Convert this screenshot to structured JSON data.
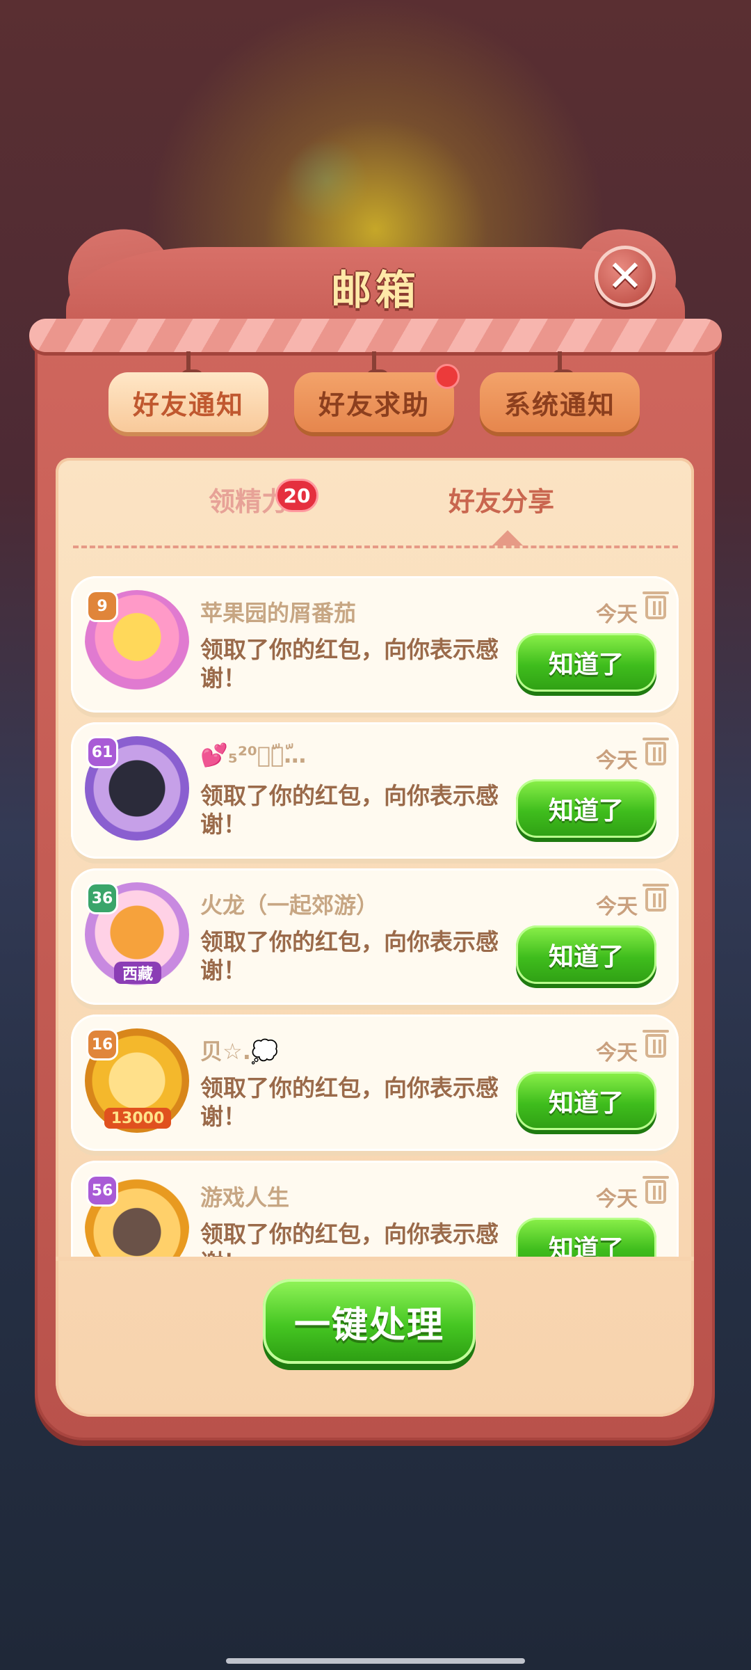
{
  "window": {
    "title": "邮箱",
    "close_icon": "close-icon"
  },
  "tabs": [
    {
      "label": "好友通知",
      "active": true,
      "notify": false
    },
    {
      "label": "好友求助",
      "active": false,
      "notify": true
    },
    {
      "label": "系统通知",
      "active": false,
      "notify": false
    }
  ],
  "subtabs": {
    "energy": {
      "label": "领精力",
      "badge": "20"
    },
    "share": {
      "label": "好友分享"
    }
  },
  "messages": [
    {
      "name": "苹果园的屑番茄",
      "level": "9",
      "level_color": "#e0853a",
      "date": "今天",
      "text": "领取了你的红包，向你表示感谢！",
      "button": "知道了",
      "avatar_caption": ""
    },
    {
      "name": "💕₅²⁰遇ّ见ّ…",
      "level": "61",
      "level_color": "#a95bd6",
      "date": "今天",
      "text": "领取了你的红包，向你表示感谢！",
      "button": "知道了",
      "avatar_caption": ""
    },
    {
      "name": "火龙（一起郊游）",
      "level": "36",
      "level_color": "#3aa56a",
      "date": "今天",
      "text": "领取了你的红包，向你表示感谢！",
      "button": "知道了",
      "avatar_caption": "西藏"
    },
    {
      "name": "贝☆.💭",
      "level": "16",
      "level_color": "#e0853a",
      "date": "今天",
      "text": "领取了你的红包，向你表示感谢！",
      "button": "知道了",
      "avatar_caption": "13000"
    },
    {
      "name": "游戏人生",
      "level": "56",
      "level_color": "#a95bd6",
      "date": "今天",
      "text": "领取了你的红包，向你表示感谢！",
      "button": "知道了",
      "avatar_caption": ""
    }
  ],
  "footer": {
    "process_all": "一键处理"
  },
  "colors": {
    "frame": "#c65c54",
    "panel": "#fbe3c3",
    "button_green": "#3fbd1d",
    "badge_red": "#e52f3e"
  }
}
